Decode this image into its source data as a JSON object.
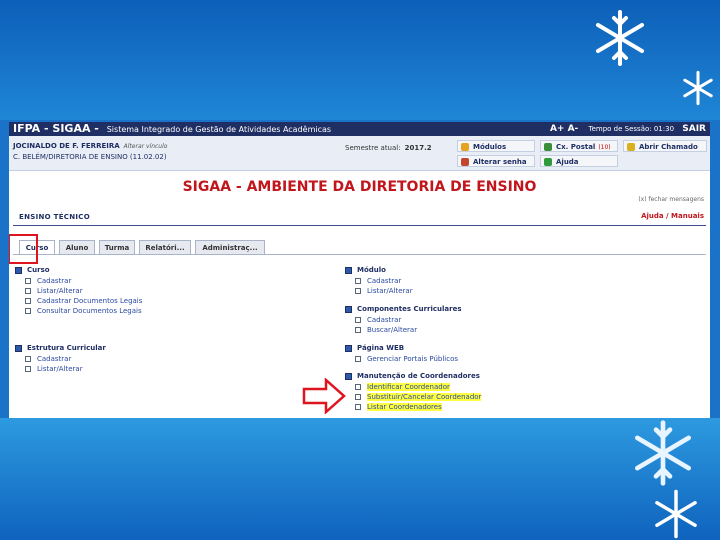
{
  "top_bar": {
    "system_name": "IFPA - SIGAA -",
    "system_subtitle": "Sistema Integrado de Gestão de Atividades Acadêmicas",
    "font_control": "A+ A-",
    "session_label": "Tempo de Sessão: 01:30",
    "logout_label": "SAIR"
  },
  "info_bar": {
    "user_name": "JOCINALDO DE F. FERREIRA",
    "change_link": "Alterar vínculo",
    "unit_name": "C. BELÉM/DIRETORIA DE ENSINO (11.02.02)",
    "semester_label": "Semestre atual:",
    "semester_value": "2017.2"
  },
  "quick_menu": {
    "modulos": "Módulos",
    "caixa_postal": "Cx. Postal",
    "caixa_postal_count": "(10)",
    "abrir_chamado": "Abrir Chamado",
    "alterar_senha": "Alterar senha",
    "ajuda": "Ajuda"
  },
  "page": {
    "title": "SIGAA - AMBIENTE DA DIRETORIA DE ENSINO",
    "close_messages": "(x) fechar mensagens",
    "module_name": "ENSINO TÉCNICO",
    "help_links": "Ajuda / Manuais"
  },
  "tabs": [
    "Curso",
    "Aluno",
    "Turma",
    "Relatóri...",
    "Administraç..."
  ],
  "left_sections": [
    {
      "title": "Curso",
      "items": [
        "Cadastrar",
        "Listar/Alterar",
        "Cadastrar Documentos Legais",
        "Consultar Documentos Legais"
      ]
    },
    {
      "title": "Estrutura Curricular",
      "items": [
        "Cadastrar",
        "Listar/Alterar"
      ]
    }
  ],
  "right_sections": [
    {
      "title": "Módulo",
      "items": [
        "Cadastrar",
        "Listar/Alterar"
      ]
    },
    {
      "title": "Componentes Curriculares",
      "items": [
        "Cadastrar",
        "Buscar/Alterar"
      ]
    },
    {
      "title": "Página WEB",
      "items": [
        "Gerenciar Portais Públicos"
      ]
    },
    {
      "title": "Manutenção de Coordenadores",
      "items": [
        "Identificar Coordenador",
        "Substituir/Cancelar Coordenador",
        "Listar Coordenadores"
      ]
    }
  ],
  "colors": {
    "highlight_box": "#e0141e",
    "highlight_text": "#ffff40",
    "title_red": "#c0161c",
    "header_navy": "#1f2e63"
  },
  "icons": {
    "arrow": "arrow-right-icon",
    "flake": "snowflake-icon"
  }
}
